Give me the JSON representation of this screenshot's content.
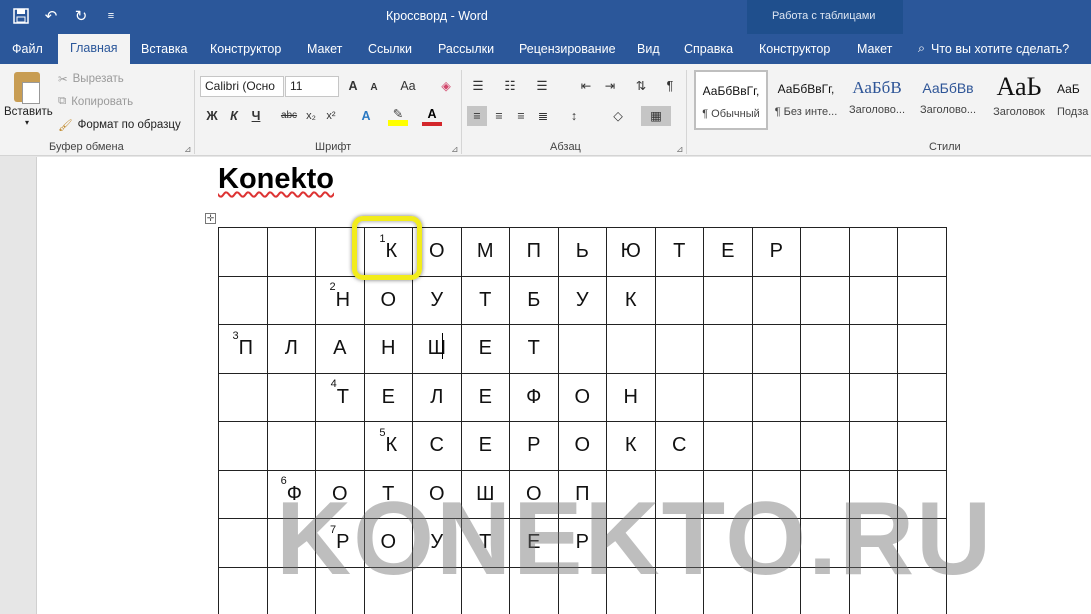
{
  "window": {
    "title": "Кроссворд - Word",
    "context_tab_group": "Работа с таблицами"
  },
  "qat": {
    "save_icon": "save-icon",
    "undo_icon": "undo-icon",
    "redo_icon": "redo-icon",
    "customize_icon": "customize-icon"
  },
  "tabs": [
    {
      "label": "Файл"
    },
    {
      "label": "Главная"
    },
    {
      "label": "Вставка"
    },
    {
      "label": "Конструктор"
    },
    {
      "label": "Макет"
    },
    {
      "label": "Ссылки"
    },
    {
      "label": "Рассылки"
    },
    {
      "label": "Рецензирование"
    },
    {
      "label": "Вид"
    },
    {
      "label": "Справка"
    },
    {
      "label": "Конструктор"
    },
    {
      "label": "Макет"
    }
  ],
  "tell_me": "Что вы хотите сделать?",
  "ribbon": {
    "clipboard": {
      "paste": "Вставить",
      "cut": "Вырезать",
      "copy": "Копировать",
      "format_painter": "Формат по образцу",
      "group_label": "Буфер обмена"
    },
    "font": {
      "font_name": "Calibri (Осно",
      "font_size": "11",
      "bold": "Ж",
      "italic": "К",
      "underline": "Ч",
      "strike": "abc",
      "subscript": "x₂",
      "superscript": "x²",
      "grow": "A",
      "shrink": "A",
      "case": "Aa",
      "group_label": "Шрифт"
    },
    "paragraph": {
      "group_label": "Абзац"
    },
    "styles": {
      "group_label": "Стили",
      "items": [
        {
          "sample": "АаБбВвГг,",
          "name": "¶ Обычный"
        },
        {
          "sample": "АаБбВвГг,",
          "name": "¶ Без инте..."
        },
        {
          "sample": "АаБбВ",
          "name": "Заголово..."
        },
        {
          "sample": "АаБбВв",
          "name": "Заголово..."
        },
        {
          "sample": "АаЬ",
          "name": "Заголовок"
        },
        {
          "sample": "АаБ",
          "name": "Подза"
        }
      ]
    }
  },
  "document": {
    "heading": "Konekto",
    "watermark": "KONEKTO.RU",
    "grid": [
      [
        "",
        "",
        "",
        "1|К",
        "О",
        "М",
        "П",
        "Ь",
        "Ю",
        "Т",
        "Е",
        "Р",
        "",
        "",
        ""
      ],
      [
        "",
        "",
        "2|Н",
        "О",
        "У",
        "Т",
        "Б",
        "У",
        "К",
        "",
        "",
        "",
        "",
        "",
        ""
      ],
      [
        "3|П",
        "Л",
        "А",
        "Н",
        "Ш",
        "Е",
        "Т",
        "",
        "",
        "",
        "",
        "",
        "",
        "",
        ""
      ],
      [
        "",
        "",
        "4|Т",
        "Е",
        "Л",
        "Е",
        "Ф",
        "О",
        "Н",
        "",
        "",
        "",
        "",
        "",
        ""
      ],
      [
        "",
        "",
        "",
        "5|К",
        "С",
        "Е",
        "Р",
        "О",
        "К",
        "С",
        "",
        "",
        "",
        "",
        ""
      ],
      [
        "",
        "6|Ф",
        "О",
        "Т",
        "О",
        "Ш",
        "О",
        "П",
        "",
        "",
        "",
        "",
        "",
        "",
        ""
      ],
      [
        "",
        "",
        "7|Р",
        "О",
        "У",
        "Т",
        "Е",
        "Р",
        "",
        "",
        "",
        "",
        "",
        "",
        ""
      ],
      [
        "",
        "",
        "",
        "",
        "",
        "",
        "",
        "",
        "",
        "",
        "",
        "",
        "",
        "",
        ""
      ]
    ]
  }
}
